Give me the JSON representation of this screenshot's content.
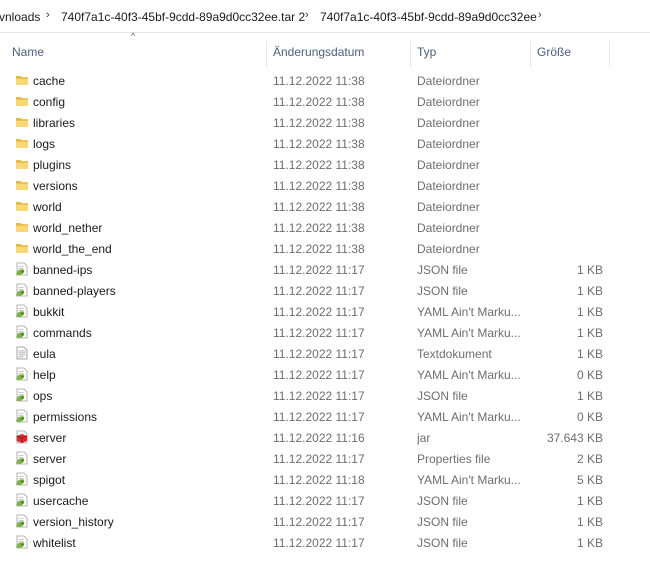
{
  "breadcrumb": {
    "items": [
      "vnloads",
      "740f7a1c-40f3-45bf-9cdd-89a9d0cc32ee.tar 2",
      "740f7a1c-40f3-45bf-9cdd-89a9d0cc32ee"
    ],
    "separator": "›"
  },
  "columns": {
    "name": "Name",
    "date": "Änderungsdatum",
    "type": "Typ",
    "size": "Größe",
    "sort_indicator": "^"
  },
  "files": [
    {
      "name": "cache",
      "date": "11.12.2022 11:38",
      "type": "Dateiordner",
      "size": "",
      "icon": "folder-icon"
    },
    {
      "name": "config",
      "date": "11.12.2022 11:38",
      "type": "Dateiordner",
      "size": "",
      "icon": "folder-icon"
    },
    {
      "name": "libraries",
      "date": "11.12.2022 11:38",
      "type": "Dateiordner",
      "size": "",
      "icon": "folder-icon"
    },
    {
      "name": "logs",
      "date": "11.12.2022 11:38",
      "type": "Dateiordner",
      "size": "",
      "icon": "folder-icon"
    },
    {
      "name": "plugins",
      "date": "11.12.2022 11:38",
      "type": "Dateiordner",
      "size": "",
      "icon": "folder-icon"
    },
    {
      "name": "versions",
      "date": "11.12.2022 11:38",
      "type": "Dateiordner",
      "size": "",
      "icon": "folder-icon"
    },
    {
      "name": "world",
      "date": "11.12.2022 11:38",
      "type": "Dateiordner",
      "size": "",
      "icon": "folder-icon"
    },
    {
      "name": "world_nether",
      "date": "11.12.2022 11:38",
      "type": "Dateiordner",
      "size": "",
      "icon": "folder-icon"
    },
    {
      "name": "world_the_end",
      "date": "11.12.2022 11:38",
      "type": "Dateiordner",
      "size": "",
      "icon": "folder-icon"
    },
    {
      "name": "banned-ips",
      "date": "11.12.2022 11:17",
      "type": "JSON file",
      "size": "1 KB",
      "icon": "notepadpp-file-icon"
    },
    {
      "name": "banned-players",
      "date": "11.12.2022 11:17",
      "type": "JSON file",
      "size": "1 KB",
      "icon": "notepadpp-file-icon"
    },
    {
      "name": "bukkit",
      "date": "11.12.2022 11:17",
      "type": "YAML Ain't Marku...",
      "size": "1 KB",
      "icon": "notepadpp-file-icon"
    },
    {
      "name": "commands",
      "date": "11.12.2022 11:17",
      "type": "YAML Ain't Marku...",
      "size": "1 KB",
      "icon": "notepadpp-file-icon"
    },
    {
      "name": "eula",
      "date": "11.12.2022 11:17",
      "type": "Textdokument",
      "size": "1 KB",
      "icon": "text-document-icon"
    },
    {
      "name": "help",
      "date": "11.12.2022 11:17",
      "type": "YAML Ain't Marku...",
      "size": "0 KB",
      "icon": "notepadpp-file-icon"
    },
    {
      "name": "ops",
      "date": "11.12.2022 11:17",
      "type": "JSON file",
      "size": "1 KB",
      "icon": "notepadpp-file-icon"
    },
    {
      "name": "permissions",
      "date": "11.12.2022 11:17",
      "type": "YAML Ain't Marku...",
      "size": "0 KB",
      "icon": "notepadpp-file-icon"
    },
    {
      "name": "server",
      "date": "11.12.2022 11:16",
      "type": "jar",
      "size": "37.643 KB",
      "icon": "jar-file-icon"
    },
    {
      "name": "server",
      "date": "11.12.2022 11:17",
      "type": "Properties file",
      "size": "2 KB",
      "icon": "notepadpp-file-icon"
    },
    {
      "name": "spigot",
      "date": "11.12.2022 11:18",
      "type": "YAML Ain't Marku...",
      "size": "5 KB",
      "icon": "notepadpp-file-icon"
    },
    {
      "name": "usercache",
      "date": "11.12.2022 11:17",
      "type": "JSON file",
      "size": "1 KB",
      "icon": "notepadpp-file-icon"
    },
    {
      "name": "version_history",
      "date": "11.12.2022 11:17",
      "type": "JSON file",
      "size": "1 KB",
      "icon": "notepadpp-file-icon"
    },
    {
      "name": "whitelist",
      "date": "11.12.2022 11:17",
      "type": "JSON file",
      "size": "1 KB",
      "icon": "notepadpp-file-icon"
    }
  ],
  "colors": {
    "folder": "#f8d775",
    "folder_dark": "#e5b94a",
    "header_text": "#4c607a",
    "meta_text": "#6d6d6d",
    "npp_green": "#7cb342",
    "jar_red": "#d32f2f"
  }
}
